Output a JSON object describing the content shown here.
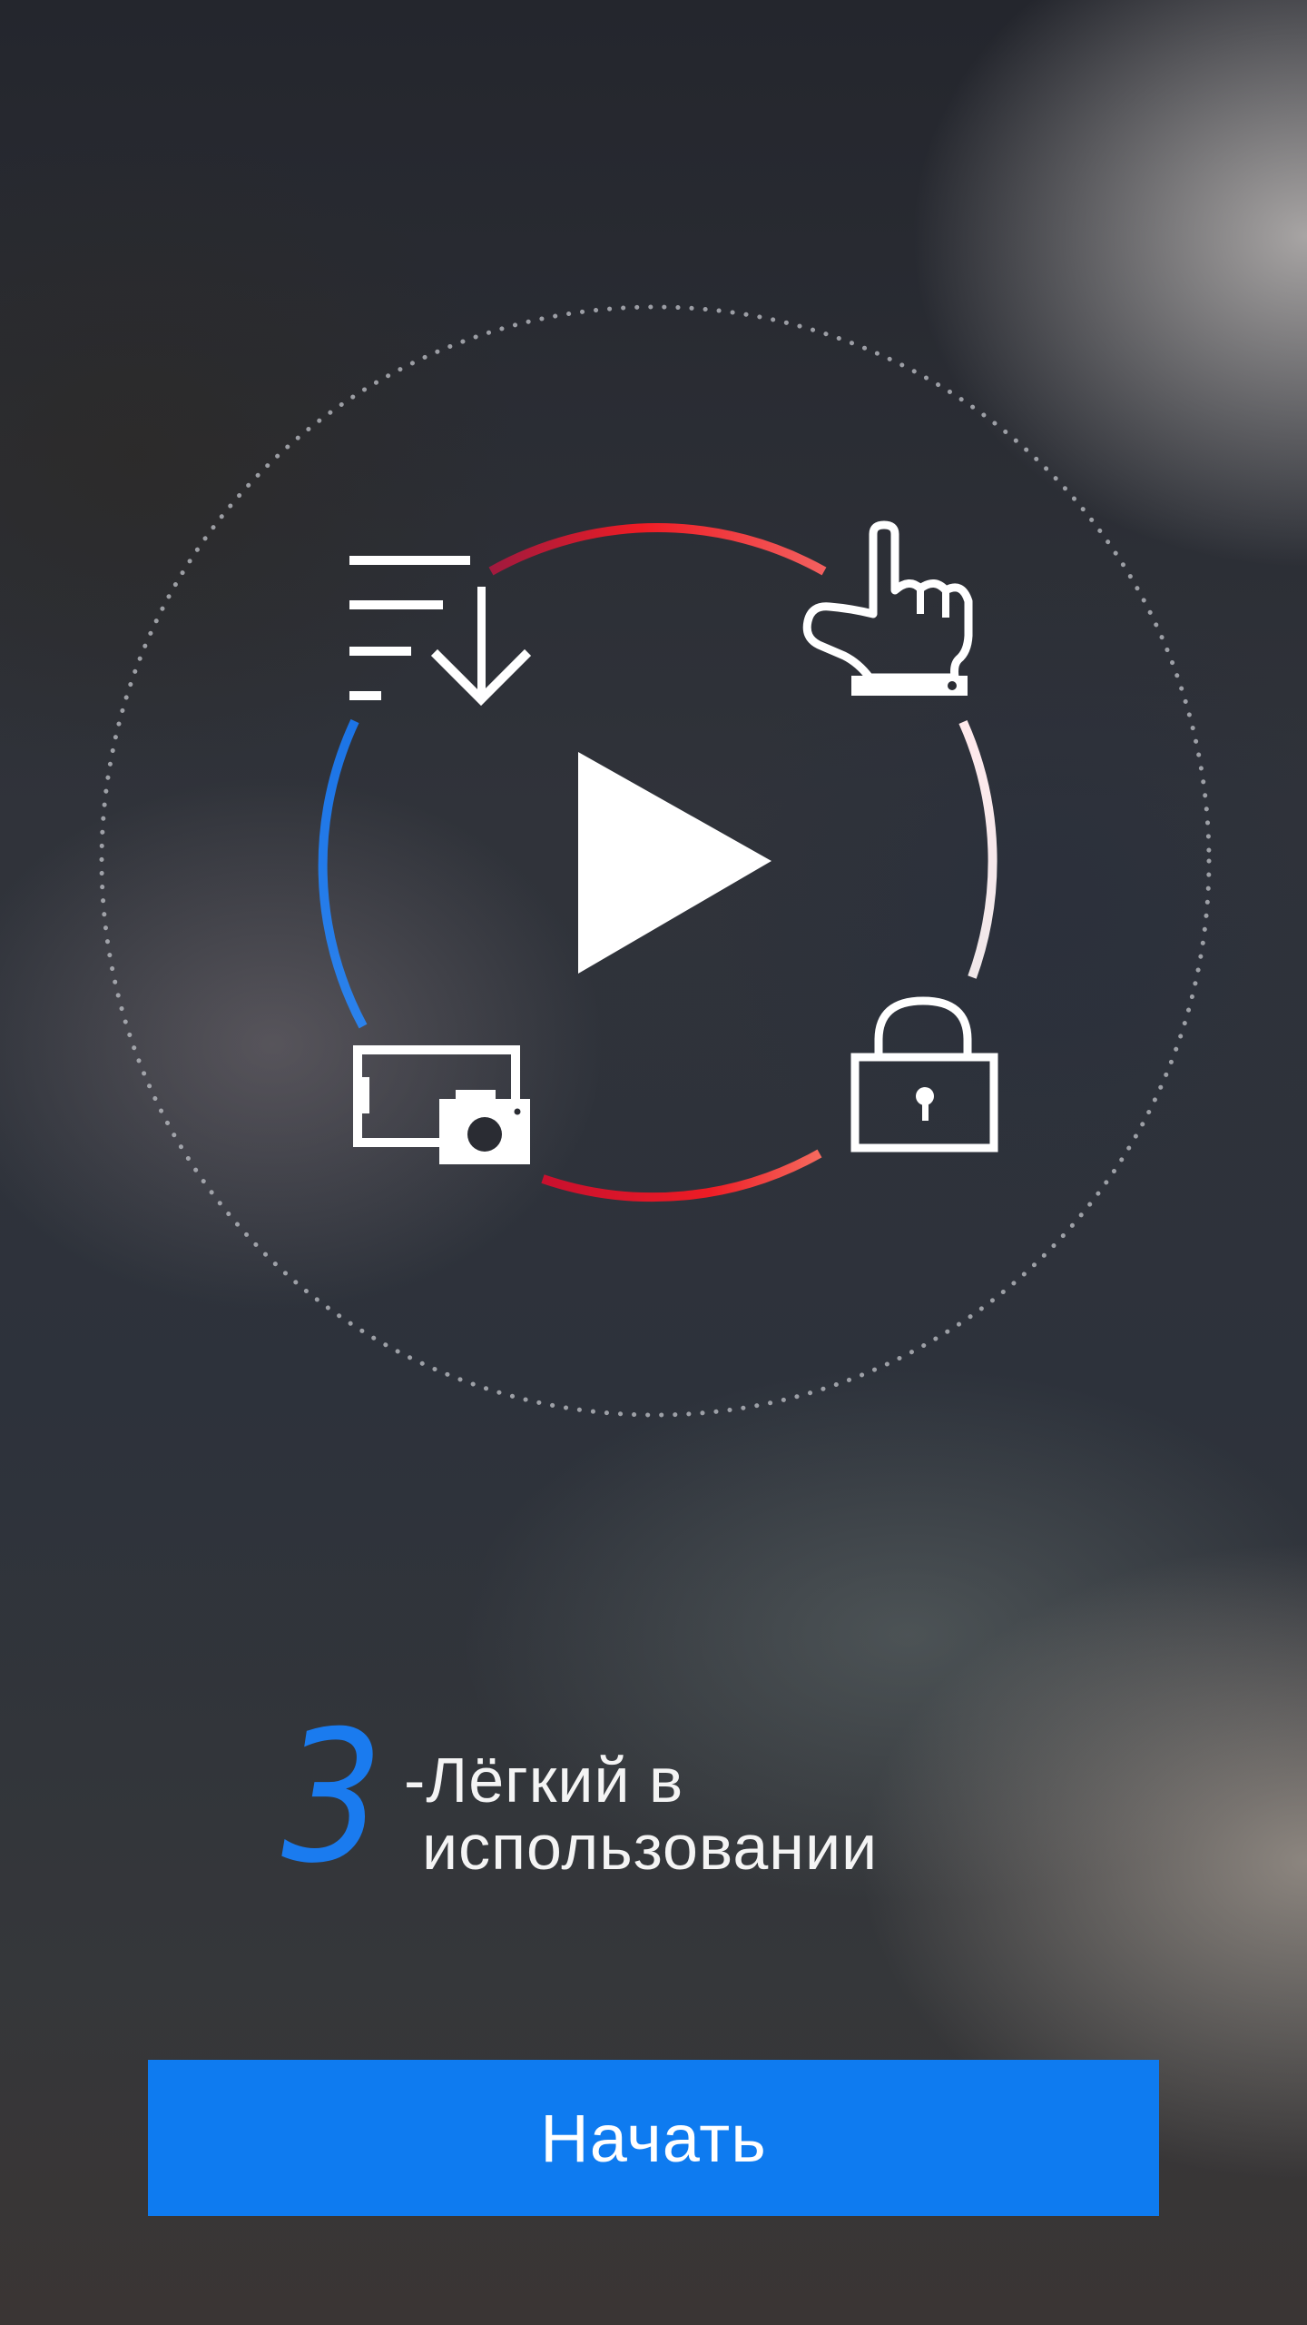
{
  "onboarding": {
    "step_number": "3",
    "step_title_line1": "-Лёгкий в",
    "step_title_line2": "использовании"
  },
  "start_button": {
    "label": "Начать"
  },
  "icons": [
    "play-icon",
    "download-list-icon",
    "tap-gesture-icon",
    "lock-icon",
    "screenshot-camera-icon"
  ],
  "colors": {
    "accent_blue": "#0e7bf0",
    "step_number_blue": "#1a7bef",
    "arc_red": "#ee1c25",
    "arc_white": "#f5e8ea",
    "text": "#f4f4f4"
  }
}
